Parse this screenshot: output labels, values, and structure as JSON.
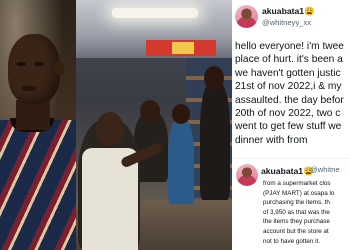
{
  "tweet_1": {
    "display_name": "akuabata1😩",
    "handle": "@whitneyy_xx",
    "lines": [
      "hello everyone! i'm twee",
      "place of hurt. it's been a",
      "we haven't gotten justic",
      "21st of nov 2022,i & my",
      "assaulted. the day befor",
      "20th of nov 2022, two c",
      "went to get few stuff we",
      "dinner with from"
    ]
  },
  "tweet_2": {
    "display_name": "akuabata1😩",
    "handle": "@whitne",
    "lines": [
      "from a supermarket clos",
      "(PJAY MART) at osapa lo",
      "purchasing the items, th",
      "of 3,950 as that was the",
      "the items they purchase",
      "account but the store at",
      "not to have gotten it."
    ]
  },
  "colors": {
    "text_primary": "#0f1419",
    "text_secondary": "#536471"
  }
}
